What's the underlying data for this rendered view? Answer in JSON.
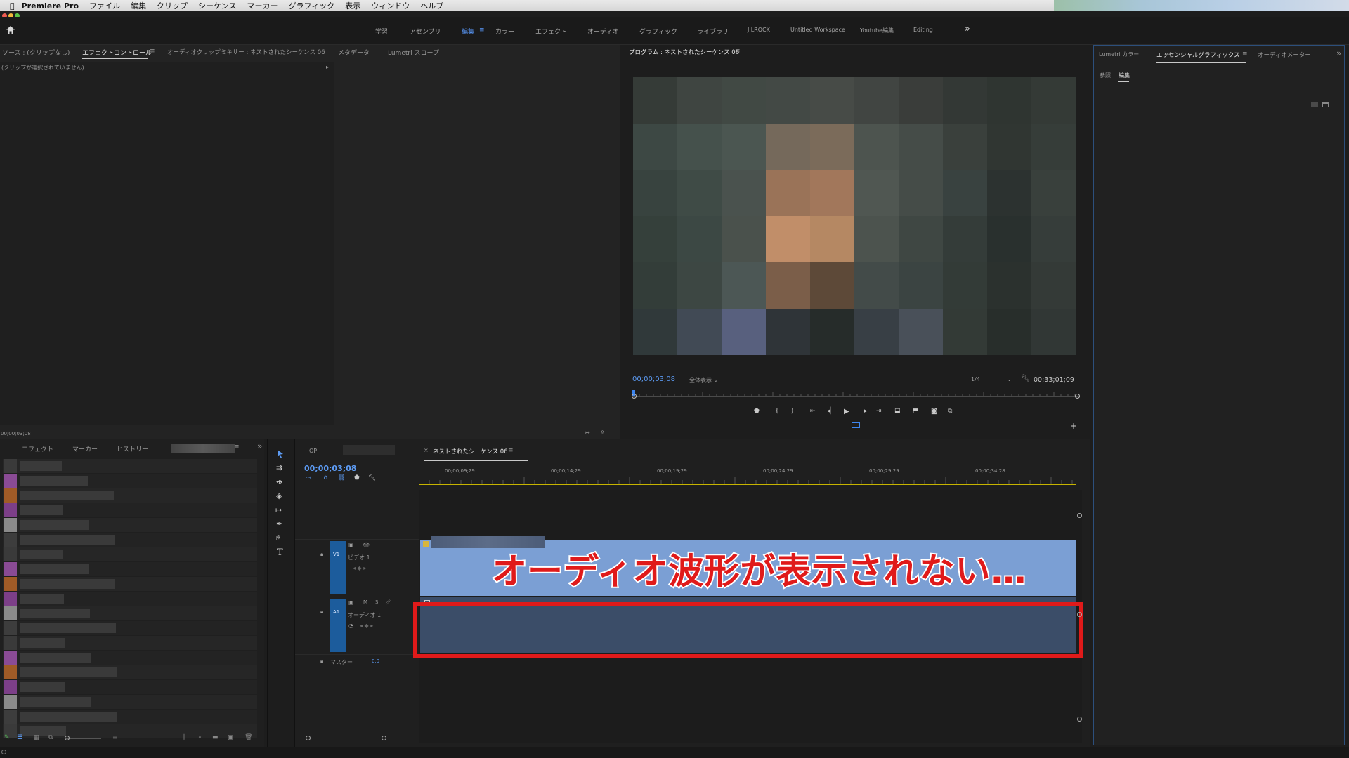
{
  "menubar": {
    "app": "Premiere Pro",
    "items": [
      "ファイル",
      "編集",
      "クリップ",
      "シーケンス",
      "マーカー",
      "グラフィック",
      "表示",
      "ウィンドウ",
      "ヘルプ"
    ]
  },
  "workspaces": {
    "items": [
      "学習",
      "アセンブリ",
      "編集",
      "カラー",
      "エフェクト",
      "オーディオ",
      "グラフィック",
      "ライブラリ",
      "JILROCK",
      "Untitled Workspace",
      "Youtube編集",
      "Editing"
    ],
    "active": "編集",
    "more": "»"
  },
  "source_panel": {
    "tabs": [
      "ソース : (クリップなし)",
      "エフェクトコントロール",
      "オーディオクリップミキサー : ネストされたシーケンス 06",
      "メタデータ",
      "Lumetri スコープ"
    ],
    "active_tab": "エフェクトコントロール",
    "no_clip": "(クリップが選択されていません)",
    "timecode": "00;00;03;08"
  },
  "program_monitor": {
    "title": "プログラム : ネストされたシーケンス 06",
    "timecode": "00;00;03;08",
    "fit": "全体表示",
    "resolution": "1/4",
    "duration": "00;33;01;09"
  },
  "right_panel": {
    "tabs": [
      "Lumetri カラー",
      "エッセンシャルグラフィックス",
      "オーディオメーター"
    ],
    "active_tab": "エッセンシャルグラフィックス",
    "subtabs": [
      "参照",
      "編集"
    ],
    "active_subtab": "編集"
  },
  "project_panel": {
    "tabs": [
      "エフェクト",
      "マーカー",
      "ヒストリー"
    ]
  },
  "timeline": {
    "tabs": [
      "OP",
      "ネストされたシーケンス 06"
    ],
    "active_tab": "ネストされたシーケンス 06",
    "close": "×",
    "timecode": "00;00;03;08",
    "ruler": [
      "00;00;09;29",
      "00;00;14;29",
      "00;00;19;29",
      "00;00;24;29",
      "00;00;29;29",
      "00;00;34;28"
    ],
    "tracks": {
      "v1": {
        "id": "V1",
        "name": "ビデオ 1"
      },
      "a1": {
        "id": "A1",
        "name": "オーディオ 1",
        "m": "M",
        "s": "S"
      },
      "master": {
        "name": "マスター",
        "value": "0.0"
      }
    },
    "overlay_caption": "オーディオ波形が表示されない…"
  },
  "colors": {
    "accent": "#5d9cf5",
    "video_clip": "#7b9fd4",
    "audio_clip": "#3b4d68",
    "highlight_box": "#e01a1a",
    "track_header": "#1c5c9c"
  }
}
